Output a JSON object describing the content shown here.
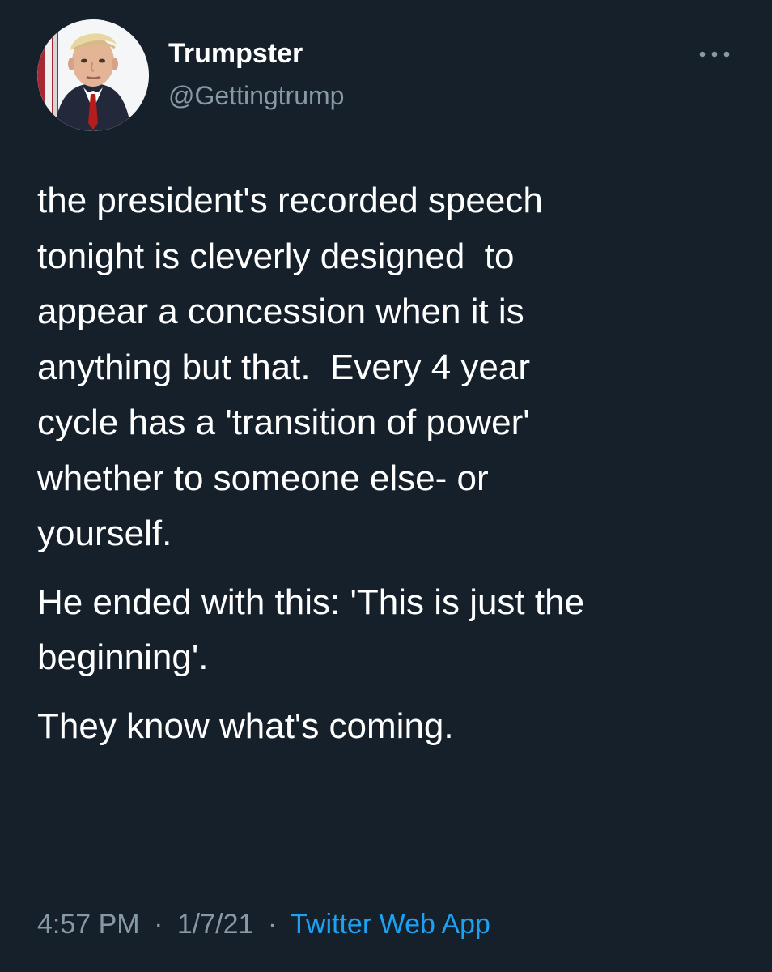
{
  "colors": {
    "background": "#15202b",
    "primary_text": "#ffffff",
    "secondary_text": "#8899a6",
    "accent": "#1da1f2"
  },
  "author": {
    "display_name": "Trumpster",
    "handle": "@Gettingtrump",
    "avatar_icon": "profile-photo"
  },
  "more_icon": "more-options-icon",
  "tweet": {
    "paragraphs": [
      {
        "lines": [
          "the president's recorded speech",
          "tonight is cleverly designed  to",
          "appear a concession when it is",
          "anything but that.  Every 4 year",
          "cycle has a 'transition of power'",
          "whether to someone else- or",
          "yourself."
        ]
      },
      {
        "lines": [
          "He ended with this: 'This is just the",
          "beginning'."
        ]
      },
      {
        "lines": [
          "They know what's coming."
        ]
      }
    ]
  },
  "meta": {
    "time": "4:57 PM",
    "separator": "·",
    "date": "1/7/21",
    "source": "Twitter Web App"
  }
}
